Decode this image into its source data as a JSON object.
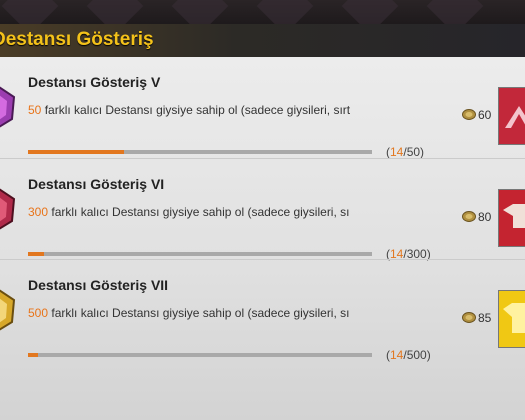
{
  "header": {
    "title": "Destansı Gösteriş"
  },
  "achievements": [
    {
      "name": "Destansı Gösteriş V",
      "target": "50",
      "description": " farklı kalıcı Destansı giysiye sahip ol (sadece giysileri, sırt",
      "progress_current": "14",
      "progress_total": "/50)",
      "progress_open": "(",
      "progress_fraction": 0.28,
      "reward": "60",
      "medal_color": "#9b3db0",
      "reward_bg": "#c2283a"
    },
    {
      "name": "Destansı Gösteriş VI",
      "target": "300",
      "description": " farklı kalıcı Destansı giysiye sahip ol (sadece giysileri, sı",
      "progress_current": "14",
      "progress_total": "/300)",
      "progress_open": "(",
      "progress_fraction": 0.047,
      "reward": "80",
      "medal_color": "#b02a4a",
      "reward_bg": "#c42430"
    },
    {
      "name": "Destansı Gösteriş VII",
      "target": "500",
      "description": " farklı kalıcı Destansı giysiye sahip ol (sadece giysileri, sı",
      "progress_current": "14",
      "progress_total": "/500)",
      "progress_open": "(",
      "progress_fraction": 0.028,
      "reward": "85",
      "medal_color": "#d7a82a",
      "reward_bg": "#f0c814"
    }
  ]
}
